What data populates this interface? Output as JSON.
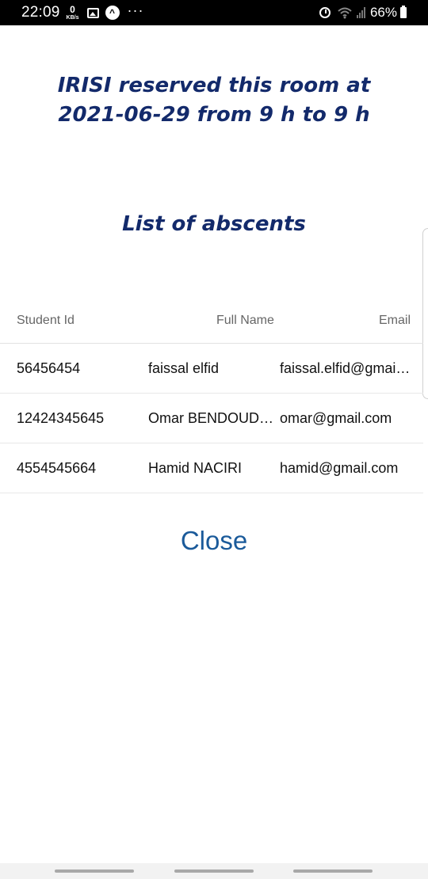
{
  "status_bar": {
    "time": "22:09",
    "data_rate_value": "0",
    "data_rate_unit": "KB/s",
    "notification_icons": [
      "image-icon",
      "app-circle-icon",
      "more-dots-icon"
    ],
    "right_icons": [
      "alarm-icon",
      "wifi-icon",
      "signal-icon",
      "battery-icon"
    ],
    "battery_percent": "66%"
  },
  "dialog": {
    "title_line1": "IRISI reserved this room at",
    "title_line2": "2021-06-29 from 9 h to 9 h",
    "subtitle": "List of abscents",
    "table": {
      "headers": [
        "Student Id",
        "Full Name",
        "Email"
      ],
      "rows": [
        {
          "id": "56456454",
          "name": "faissal elfid",
          "email": "faissal.elfid@gmail.com"
        },
        {
          "id": "12424345645",
          "name": "Omar BENDOUDOUH",
          "email": "omar@gmail.com"
        },
        {
          "id": "4554545664",
          "name": "Hamid NACIRI",
          "email": "hamid@gmail.com"
        }
      ]
    },
    "close_label": "Close"
  },
  "colors": {
    "title": "#132a6b",
    "close": "#1a5a9a",
    "header_text": "#666666"
  }
}
